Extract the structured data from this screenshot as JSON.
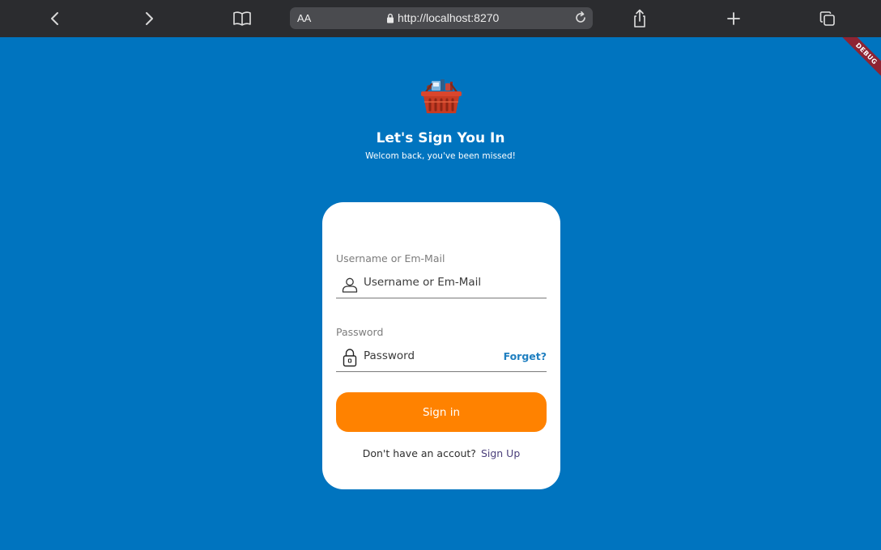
{
  "browser": {
    "text_size_label": "AA",
    "url": "http://localhost:8270"
  },
  "debug_banner": "DEBUG",
  "header": {
    "title": "Let's Sign You In",
    "subtitle": "Welcom back, you've been missed!"
  },
  "form": {
    "username": {
      "label": "Username or Em-Mail",
      "placeholder": "Username or Em-Mail",
      "value": ""
    },
    "password": {
      "label": "Password",
      "placeholder": "Password",
      "value": "",
      "forgot_label": "Forget?"
    },
    "signin_label": "Sign in",
    "signup_prompt": "Don't have an accout?",
    "signup_label": "Sign Up"
  },
  "colors": {
    "background": "#0074bf",
    "primary_button": "#ff8200",
    "link": "#1f7fc0",
    "signup_link": "#4a3e7a"
  },
  "icons": {
    "back": "chevron-left-icon",
    "forward": "chevron-right-icon",
    "reader": "book-icon",
    "lock": "lock-icon",
    "reload": "reload-icon",
    "share": "share-icon",
    "new_tab": "plus-icon",
    "tabs": "tabs-icon",
    "logo": "shopping-basket-icon",
    "username": "user-icon",
    "password": "padlock-icon"
  }
}
